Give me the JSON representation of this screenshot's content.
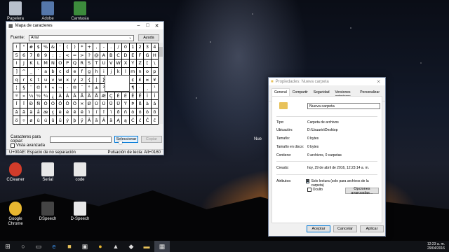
{
  "desktop": {
    "icons": [
      {
        "label": "Papelera",
        "color": "#b8c0cc"
      },
      {
        "label": "Adobe",
        "color": "#5577aa"
      },
      {
        "label": "Camtasia",
        "color": "#3c8b3c"
      },
      {
        "label": "CCleaner",
        "color": "#d23c2a"
      },
      {
        "label": "Serial",
        "color": "#e8e8e8"
      },
      {
        "label": "code",
        "color": "#e8e8e8"
      },
      {
        "label": "Google Chrome",
        "color": "#e8b730"
      },
      {
        "label": "DSpeech",
        "color": "#444444"
      },
      {
        "label": "D-Speech",
        "color": "#e8e8e8"
      }
    ],
    "partial_icon_text": "Nue"
  },
  "charmap": {
    "title": "Mapa de caracteres",
    "font_label": "Fuente:",
    "font_value": "Arial",
    "help_label": "Ayuda",
    "chars": [
      "!",
      "\"",
      "#",
      "$",
      "%",
      "&",
      "'",
      "(",
      ")",
      "*",
      "+",
      ",",
      "-",
      ".",
      "/",
      "0",
      "1",
      "2",
      "3",
      "4",
      "5",
      "6",
      "7",
      "8",
      "9",
      ":",
      ";",
      "<",
      "=",
      ">",
      "?",
      "@",
      "A",
      "B",
      "C",
      "D",
      "E",
      "F",
      "G",
      "H",
      "I",
      "J",
      "K",
      "L",
      "M",
      "N",
      "O",
      "P",
      "Q",
      "R",
      "S",
      "T",
      "U",
      "V",
      "W",
      "X",
      "Y",
      "Z",
      "[",
      "\\",
      "]",
      "^",
      "_",
      "`",
      "a",
      "b",
      "c",
      "d",
      "e",
      "f",
      "g",
      "h",
      "i",
      "j",
      "k",
      "l",
      "m",
      "n",
      "o",
      "p",
      "q",
      "r",
      "s",
      "t",
      "u",
      "v",
      "w",
      "x",
      "y",
      "z",
      "{",
      "|",
      "}",
      "~",
      " ",
      "¡",
      "¢",
      "£",
      "¤",
      "¥",
      "¦",
      "§",
      "¨",
      "©",
      "ª",
      "«",
      "¬",
      "-",
      "®",
      "¯",
      "°",
      "±",
      "²",
      "³",
      "´",
      "µ",
      "¶",
      "·",
      "¸",
      "¹",
      "º",
      "»",
      "¼",
      "½",
      "¾",
      "¿",
      "À",
      "Á",
      "Â",
      "Ã",
      "Ä",
      "Å",
      "Æ",
      "Ç",
      "È",
      "É",
      "Ê",
      "Ë",
      "Ì",
      "Í",
      "Î",
      "Ï",
      "Ð",
      "Ñ",
      "Ò",
      "Ó",
      "Ô",
      "Õ",
      "Ö",
      "×",
      "Ø",
      "Ù",
      "Ú",
      "Û",
      "Ü",
      "Ý",
      "Þ",
      "ß",
      "à",
      "á",
      "â",
      "ã",
      "ä",
      "å",
      "æ",
      "ç",
      "è",
      "é",
      "ê",
      "ë",
      "ì",
      "í",
      "î",
      "ï",
      "ð",
      "ñ",
      "ò",
      "ó",
      "ô",
      "õ",
      "ö",
      "÷",
      "ø",
      "ù",
      "ú",
      "û",
      "ü",
      "ý",
      "þ",
      "ÿ",
      "Ā",
      "ā",
      "Ă",
      "ă",
      "Ą",
      "ą",
      "Ć",
      "ć",
      "Ĉ",
      "ĉ"
    ],
    "copy_label": "Caracteres para copiar:",
    "select_label": "Seleccionar",
    "copy_button": "Copiar",
    "advanced_label": "Vista avanzada",
    "status_left": "U+00AE: Espacio de no separación",
    "status_right": "Pulsación de tecla: Alt+0160"
  },
  "props": {
    "title": "Propiedades: Nueva carpeta",
    "tabs": [
      "General",
      "Compartir",
      "Seguridad",
      "Versiones anteriores",
      "Personalizar"
    ],
    "name_value": "Nueva carpeta",
    "rows": [
      {
        "label": "Tipo:",
        "value": "Carpeta de archivos"
      },
      {
        "label": "Ubicación:",
        "value": "D:\\Usuario\\Desktop"
      },
      {
        "label": "Tamaño:",
        "value": "0 bytes"
      },
      {
        "label": "Tamaño en disco:",
        "value": "0 bytes"
      },
      {
        "label": "Contiene:",
        "value": "0 archivos, 0 carpetas"
      },
      {
        "label": "Creado:",
        "value": "hoy, 29 de abril de 2016, 12:23:14 a. m."
      }
    ],
    "attributes_label": "Atributos:",
    "readonly_label": "Solo lectura (solo para archivos de la carpeta)",
    "hidden_label": "Oculto",
    "advanced_button": "Opciones avanzadas...",
    "ok": "Aceptar",
    "cancel": "Cancelar",
    "apply": "Aplicar"
  },
  "taskbar": {
    "time": "12:23 a. m.",
    "date": "29/04/2016"
  }
}
